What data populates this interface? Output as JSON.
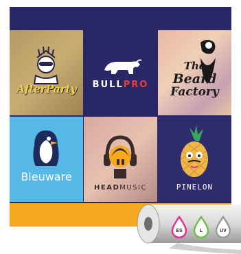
{
  "tiles": {
    "afterparty": {
      "text": "AfterParty"
    },
    "bullpro": {
      "part1": "BULL",
      "part2": "PRO"
    },
    "beard": {
      "line1": "The",
      "line2": "Beard",
      "line3": "Factory"
    },
    "bleuware": {
      "text": "Bleuware"
    },
    "headmusic": {
      "part1": "HEAD",
      "part2": "MUSIC"
    },
    "pinelon": {
      "text": "PINELON"
    }
  },
  "badges": [
    {
      "label": "ES",
      "color": "#e0338f"
    },
    {
      "label": "L",
      "color": "#6cc04a"
    },
    {
      "label": "UV",
      "color": "#9a9a9a"
    }
  ],
  "colors": {
    "poster_bg": "#2a2766",
    "bottom_bar": "#f6a91e",
    "bleuware_bg": "#55b8e7"
  },
  "icons": [
    "statue-of-liberty-icon",
    "bull-icon",
    "bearded-man-icon",
    "penguin-icon",
    "headphones-head-icon",
    "pineapple-icon",
    "vinyl-roll-icon"
  ]
}
